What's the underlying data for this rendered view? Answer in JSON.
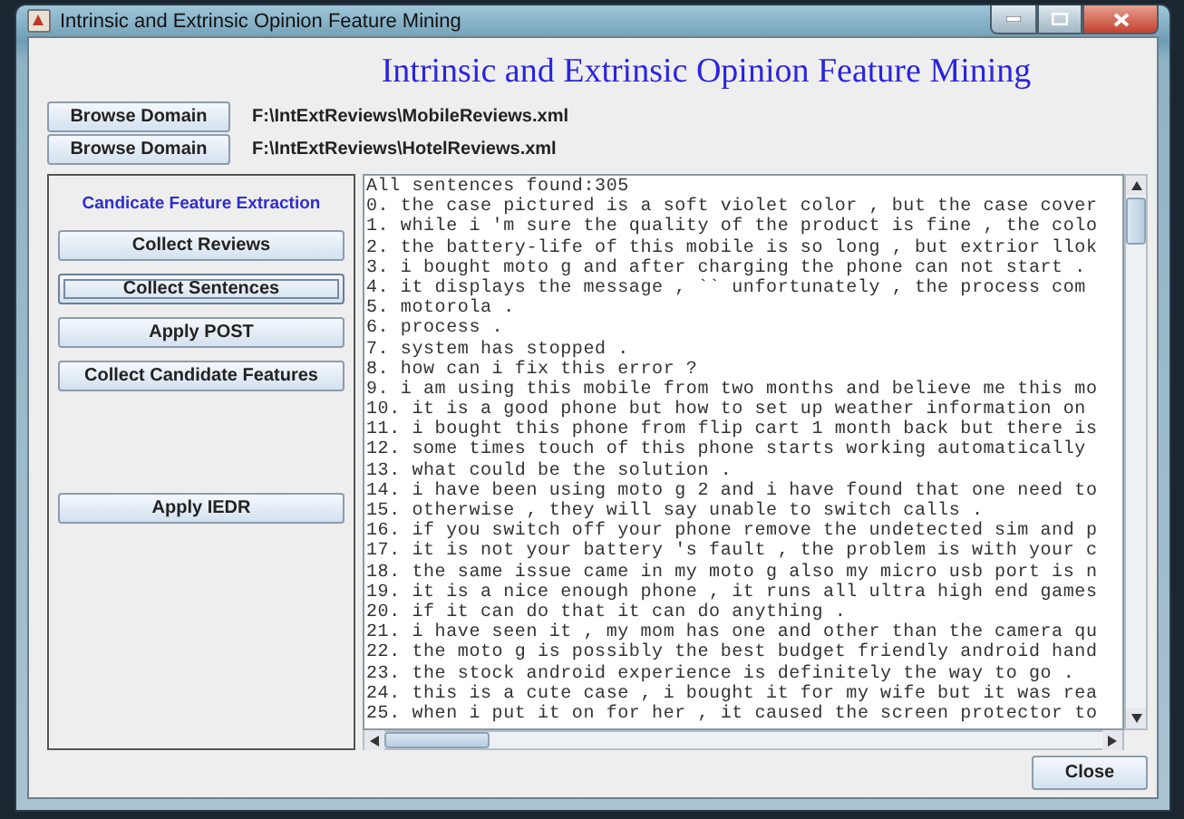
{
  "window": {
    "title": "Intrinsic and Extrinsic Opinion Feature Mining"
  },
  "heading": "Intrinsic and Extrinsic Opinion Feature Mining",
  "domains": [
    {
      "button": "Browse Domain",
      "path": "F:\\IntExtReviews\\MobileReviews.xml"
    },
    {
      "button": "Browse Domain",
      "path": "F:\\IntExtReviews\\HotelReviews.xml"
    }
  ],
  "panel": {
    "title": "Candicate Feature Extraction",
    "buttons": [
      {
        "label": "Collect Reviews",
        "focused": false,
        "spaced": false
      },
      {
        "label": "Collect Sentences",
        "focused": true,
        "spaced": false
      },
      {
        "label": "Apply POST",
        "focused": false,
        "spaced": false
      },
      {
        "label": "Collect Candidate Features",
        "focused": false,
        "spaced": false
      },
      {
        "label": "Apply IEDR",
        "focused": false,
        "spaced": true
      }
    ]
  },
  "output": {
    "lines": [
      "All sentences found:305",
      "0. the case pictured is a soft violet color , but the case cover",
      "1. while i 'm sure the quality of the product is fine , the colo",
      "2. the battery-life of this mobile is so long , but extrior llok",
      "3. i bought moto g and after charging the phone can not start .",
      "4. it displays the message , `` unfortunately , the process com",
      "5. motorola .",
      "6. process .",
      "7. system has stopped .",
      "8. how can i fix this error ?",
      "9. i am using this mobile from two months and believe me this mo",
      "10. it is a good phone but how to set up weather information on",
      "11. i bought this phone from flip cart 1 month back but there is",
      "12. some times touch of this phone starts working automatically",
      "13. what could be the solution .",
      "14. i have been using moto g 2 and i have found that one need to",
      "15. otherwise , they will say unable to switch calls .",
      "16. if you switch off your phone remove the undetected sim and p",
      "17. it is not your battery 's fault , the problem is with your c",
      "18. the same issue came in my moto g also my micro usb port is n",
      "19. it is a nice enough phone , it runs all ultra high end games",
      "20. if it can do that it can do anything .",
      "21. i have seen it , my mom has one and other than the camera qu",
      "22. the moto g is possibly the best budget friendly android hand",
      "23. the stock android experience is definitely the way to go .",
      "24. this is a cute case , i bought it for my wife but it was rea",
      "25. when i put it on for her , it caused the screen protector to"
    ]
  },
  "close_button": "Close"
}
